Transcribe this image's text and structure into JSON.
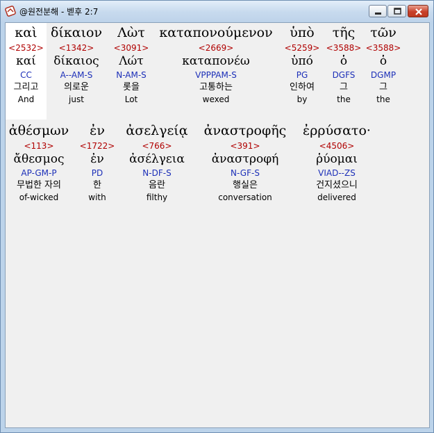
{
  "window": {
    "title": "@원전분해 - 벧후 2:7",
    "controls": {
      "minimize": "minimize",
      "maximize": "maximize",
      "close": "close"
    }
  },
  "rows": [
    {
      "words": [
        {
          "greek": "καὶ",
          "strong": "<2532>",
          "lemma": "καί",
          "morph": "CC",
          "korean": "그리고",
          "english": "And",
          "selected": true
        },
        {
          "greek": "δίκαιον",
          "strong": "<1342>",
          "lemma": "δίκαιος",
          "morph": "A--AM-S",
          "korean": "의로운",
          "english": "just"
        },
        {
          "greek": "Λὼτ",
          "strong": "<3091>",
          "lemma": "Λώτ",
          "morph": "N-AM-S",
          "korean": "롯을",
          "english": "Lot"
        },
        {
          "greek": "καταπονούμενον",
          "strong": "<2669>",
          "lemma": "καταπονέω",
          "morph": "VPPPAM-S",
          "korean": "고통하는",
          "english": "wexed"
        },
        {
          "greek": "ὑπὸ",
          "strong": "<5259>",
          "lemma": "ὑπό",
          "morph": "PG",
          "korean": "인하여",
          "english": "by"
        },
        {
          "greek": "τῆς",
          "strong": "<3588>",
          "lemma": "ὁ",
          "morph": "DGFS",
          "korean": "그",
          "english": "the"
        },
        {
          "greek": "τῶν",
          "strong": "<3588>",
          "lemma": "ὁ",
          "morph": "DGMP",
          "korean": "그",
          "english": "the"
        }
      ]
    },
    {
      "words": [
        {
          "greek": "ἀθέσμων",
          "strong": "<113>",
          "lemma": "ἄθεσμος",
          "morph": "AP-GM-P",
          "korean": "무법한 자의",
          "english": "of-wicked"
        },
        {
          "greek": "ἐν",
          "strong": "<1722>",
          "lemma": "ἐν",
          "morph": "PD",
          "korean": "한",
          "english": "with"
        },
        {
          "greek": "ἀσελγείᾳ",
          "strong": "<766>",
          "lemma": "ἀσέλγεια",
          "morph": "N-DF-S",
          "korean": "음란",
          "english": "filthy"
        },
        {
          "greek": "ἀναστροφῆς",
          "strong": "<391>",
          "lemma": "ἀναστροφή",
          "morph": "N-GF-S",
          "korean": "행실은",
          "english": "conversation"
        },
        {
          "greek": "ἐρρύσατο·",
          "strong": "<4506>",
          "lemma": "ῥύομαι",
          "morph": "VIAD--ZS",
          "korean": "건지셨으니",
          "english": "delivered"
        }
      ]
    }
  ]
}
